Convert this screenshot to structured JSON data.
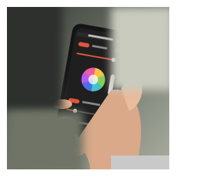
{
  "scene": {
    "subject": "hand-holding-smartphone",
    "app_screen": "lighting-control",
    "controls": {
      "toggle_1": "on",
      "toggle_2": "on",
      "toggle_3": "on",
      "slider_1_level": 0.9,
      "slider_2_level": 0.2
    },
    "colors": {
      "background_dark": "#3b3e3a",
      "background_light": "#a9ad9f",
      "phone_body": "#141414",
      "screen": "#1e1e1e",
      "accent": "#e2553a",
      "skin": "#e3b594"
    },
    "icons": [
      "color-wheel-icon",
      "toggle-switch-icon",
      "slider-icon"
    ]
  }
}
